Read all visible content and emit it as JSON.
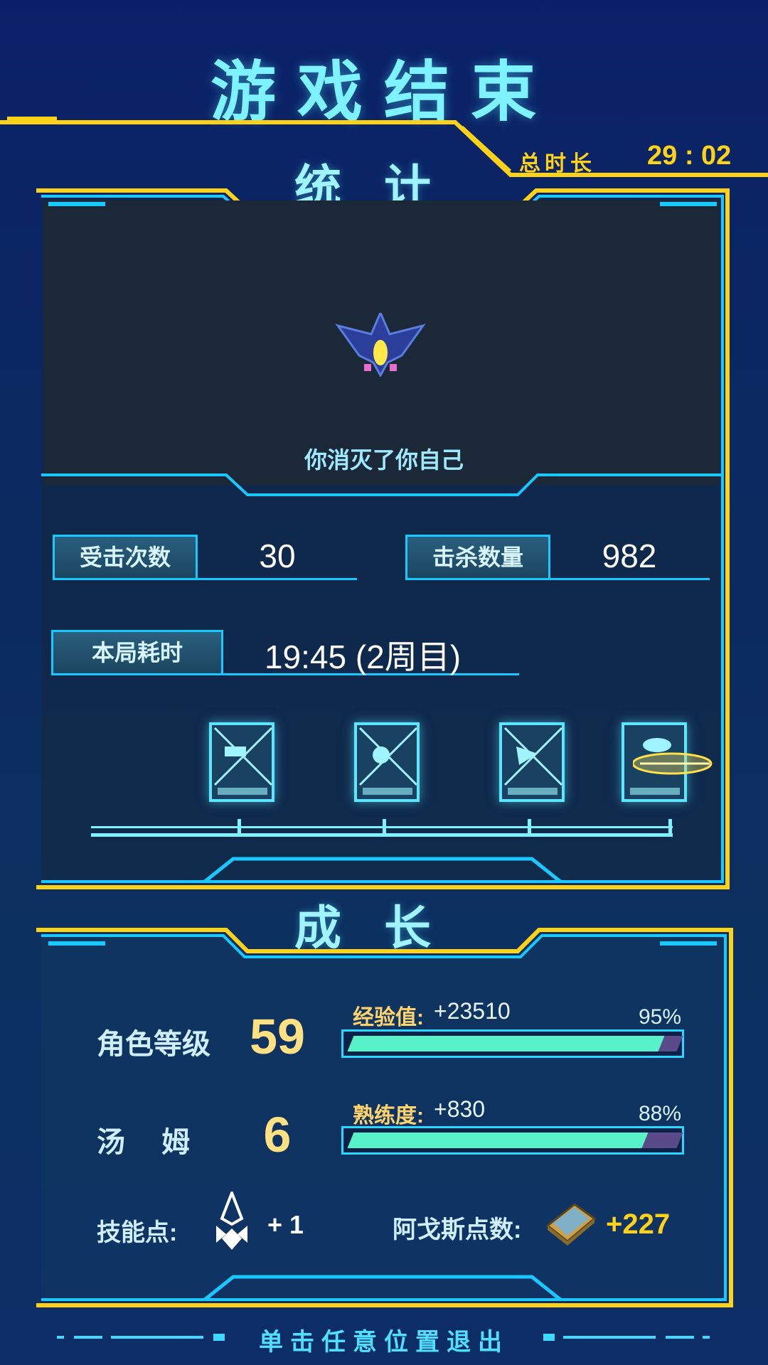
{
  "title": "游戏结束",
  "total_time": {
    "label": "总时长",
    "value": "29 : 02"
  },
  "stats": {
    "section_title": "统计",
    "defeat_message": "你消灭了你自己",
    "hits_label": "受击次数",
    "hits_value": "30",
    "kills_label": "击杀数量",
    "kills_value": "982",
    "time_label": "本局耗时",
    "time_value": "19:45 (2周目)",
    "items": [
      {
        "icon": "crossed-out-weapon-card-icon"
      },
      {
        "icon": "crossed-out-weapon-card-icon"
      },
      {
        "icon": "crossed-out-weapon-card-icon"
      },
      {
        "icon": "glowing-weapon-card-icon"
      }
    ]
  },
  "growth": {
    "section_title": "成长",
    "level": {
      "label": "角色等级",
      "value": "59",
      "exp_label": "经验值:",
      "exp_gain": "+23510",
      "percent_text": "95%",
      "progress": 0.95
    },
    "character": {
      "label": "汤 姆",
      "value": "6",
      "exp_label": "熟练度:",
      "exp_gain": "+830",
      "percent_text": "88%",
      "progress": 0.88
    },
    "skill_points": {
      "label": "技能点:",
      "value": "+ 1",
      "icon": "skill-crystal-icon"
    },
    "ago_points": {
      "label": "阿戈斯点数:",
      "value": "+227",
      "icon": "token-stack-icon"
    }
  },
  "footer": "单击任意位置退出",
  "colors": {
    "accent_cyan": "#19c8ff",
    "accent_yellow": "#ffd21a",
    "bar_fill": "#58f2c8",
    "bar_empty": "#5a4a8a"
  }
}
